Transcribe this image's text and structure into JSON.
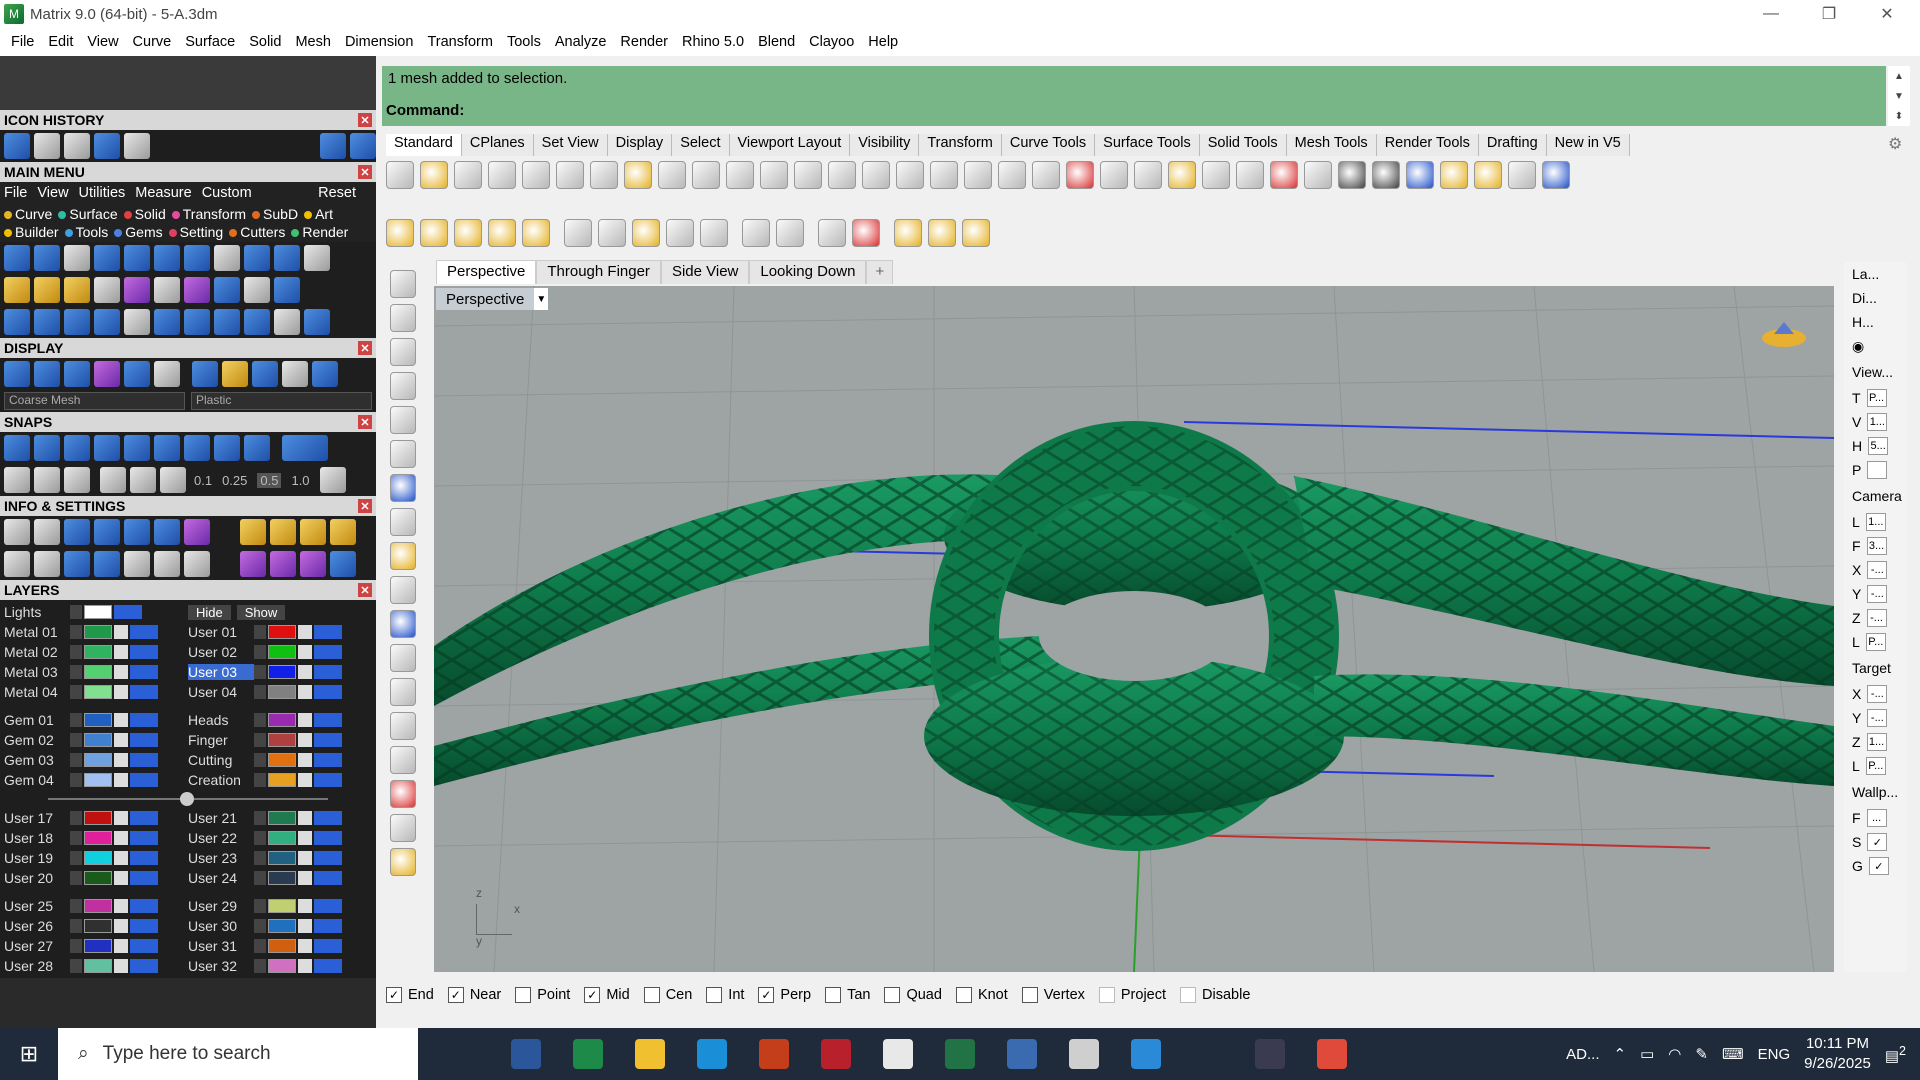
{
  "window": {
    "title": "Matrix 9.0 (64-bit) - 5-A.3dm",
    "controls": [
      "—",
      "❐",
      "✕"
    ]
  },
  "menubar": [
    "File",
    "Edit",
    "View",
    "Curve",
    "Surface",
    "Solid",
    "Mesh",
    "Dimension",
    "Transform",
    "Tools",
    "Analyze",
    "Render",
    "Rhino 5.0",
    "Blend",
    "Clayoo",
    "Help"
  ],
  "left": {
    "icon_history": "ICON HISTORY",
    "main_menu": "MAIN MENU",
    "main_menu_items": [
      "File",
      "View",
      "Utilities",
      "Measure",
      "Custom"
    ],
    "reset": "Reset",
    "categories": [
      {
        "label": "Curve",
        "color": "#e6b422"
      },
      {
        "label": "Surface",
        "color": "#2dbfa3"
      },
      {
        "label": "Solid",
        "color": "#e04040"
      },
      {
        "label": "Transform",
        "color": "#e84aa0"
      },
      {
        "label": "SubD",
        "color": "#e06820"
      },
      {
        "label": "Art",
        "color": "#f0c000"
      },
      {
        "label": "Builder",
        "color": "#f0c000"
      },
      {
        "label": "Tools",
        "color": "#40a0e0"
      },
      {
        "label": "Gems",
        "color": "#4a80e0"
      },
      {
        "label": "Setting",
        "color": "#e04060"
      },
      {
        "label": "Cutters",
        "color": "#e07020"
      },
      {
        "label": "Render",
        "color": "#40c070"
      }
    ],
    "display": "DISPLAY",
    "display_mesh": "Coarse Mesh",
    "display_material": "Plastic",
    "snaps": "SNAPS",
    "snap_values": [
      "0.1",
      "0.25",
      "0.5",
      "1.0"
    ],
    "info": "INFO & SETTINGS",
    "layers": "LAYERS",
    "lights": "Lights",
    "hide": "Hide",
    "show": "Show",
    "layer_rows": [
      [
        {
          "name": "Metal 01",
          "color": "#1f9a4a"
        },
        {
          "name": "User 01",
          "color": "#e01010"
        }
      ],
      [
        {
          "name": "Metal 02",
          "color": "#2fb360"
        },
        {
          "name": "User 02",
          "color": "#10c010"
        }
      ],
      [
        {
          "name": "Metal 03",
          "color": "#55d070"
        },
        {
          "name": "User 03",
          "color": "#1020e8",
          "selected": true
        }
      ],
      [
        {
          "name": "Metal 04",
          "color": "#80e090"
        },
        {
          "name": "User 04",
          "color": "#808080"
        }
      ]
    ],
    "layer_rows2": [
      [
        {
          "name": "Gem 01",
          "color": "#2060c0"
        },
        {
          "name": "Heads",
          "color": "#9a2ab0"
        }
      ],
      [
        {
          "name": "Gem 02",
          "color": "#4080d0"
        },
        {
          "name": "Finger",
          "color": "#b04040"
        }
      ],
      [
        {
          "name": "Gem 03",
          "color": "#70a0e0"
        },
        {
          "name": "Cutting",
          "color": "#e07010"
        }
      ],
      [
        {
          "name": "Gem 04",
          "color": "#a0c0f0"
        },
        {
          "name": "Creation",
          "color": "#e8a020"
        }
      ]
    ],
    "layer_rows3": [
      [
        {
          "name": "User 17",
          "color": "#c01010"
        },
        {
          "name": "User 21",
          "color": "#207a50"
        }
      ],
      [
        {
          "name": "User 18",
          "color": "#e0209a"
        },
        {
          "name": "User 22",
          "color": "#30b080"
        }
      ],
      [
        {
          "name": "User 19",
          "color": "#10d0e0"
        },
        {
          "name": "User 23",
          "color": "#206080"
        }
      ],
      [
        {
          "name": "User 20",
          "color": "#1a5a1a"
        },
        {
          "name": "User 24",
          "color": "#2a3a50"
        }
      ]
    ],
    "layer_rows4": [
      [
        {
          "name": "User 25",
          "color": "#c030a0"
        },
        {
          "name": "User 29",
          "color": "#c0d070"
        }
      ],
      [
        {
          "name": "User 26",
          "color": "#303030"
        },
        {
          "name": "User 30",
          "color": "#2070c0"
        }
      ],
      [
        {
          "name": "User 27",
          "color": "#2030c0"
        },
        {
          "name": "User 31",
          "color": "#d06010"
        }
      ],
      [
        {
          "name": "User 28",
          "color": "#60c0a0"
        },
        {
          "name": "User 32",
          "color": "#d070c0"
        }
      ]
    ]
  },
  "command": {
    "history": "1 mesh added to selection.",
    "prompt": "Command:"
  },
  "toolbar_tabs": [
    "Standard",
    "CPlanes",
    "Set View",
    "Display",
    "Select",
    "Viewport Layout",
    "Visibility",
    "Transform",
    "Curve Tools",
    "Surface Tools",
    "Solid Tools",
    "Mesh Tools",
    "Render Tools",
    "Drafting",
    "New in V5"
  ],
  "viewport_tabs": [
    "Perspective",
    "Through Finger",
    "Side View",
    "Looking Down"
  ],
  "viewport_tab_add": "+",
  "viewport_label": "Perspective",
  "axes": {
    "z": "z",
    "x": "x",
    "y": "y"
  },
  "right_panel": {
    "tabs": [
      "La...",
      "Di...",
      "H..."
    ],
    "view": "View...",
    "view_rows": [
      "T",
      "V",
      "H",
      "P"
    ],
    "view_values": [
      "P...",
      "1...",
      "5...",
      ""
    ],
    "camera": "Camera",
    "camera_rows": [
      "L",
      "F",
      "X",
      "Y",
      "Z",
      "L"
    ],
    "camera_values": [
      "1...",
      "3...",
      "-...",
      "-...",
      "-...",
      "P..."
    ],
    "target": "Target",
    "target_rows": [
      "X",
      "Y",
      "Z",
      "L"
    ],
    "target_values": [
      "-...",
      "-...",
      "1...",
      "P..."
    ],
    "wallpaper": "Wallp...",
    "wall_rows": [
      "F",
      "S",
      "G"
    ],
    "wall_values": [
      "...",
      "✓",
      "✓"
    ]
  },
  "osnaps": [
    {
      "label": "End",
      "checked": true
    },
    {
      "label": "Near",
      "checked": true
    },
    {
      "label": "Point",
      "checked": false
    },
    {
      "label": "Mid",
      "checked": true
    },
    {
      "label": "Cen",
      "checked": false
    },
    {
      "label": "Int",
      "checked": false
    },
    {
      "label": "Perp",
      "checked": true
    },
    {
      "label": "Tan",
      "checked": false
    },
    {
      "label": "Quad",
      "checked": false
    },
    {
      "label": "Knot",
      "checked": false
    },
    {
      "label": "Vertex",
      "checked": false
    },
    {
      "label": "Project",
      "checked": false,
      "disabled": true
    },
    {
      "label": "Disable",
      "checked": false,
      "disabled": true
    }
  ],
  "taskbar": {
    "search_placeholder": "Type here to search",
    "tray_text": "AD...",
    "lang": "ENG",
    "time": "10:11 PM",
    "date": "9/26/2025",
    "notification_count": "2",
    "apps": [
      "task-view",
      "word",
      "matrix",
      "file-explorer",
      "edge",
      "powerpoint",
      "solidworks",
      "chrome",
      "excel",
      "remote-desktop",
      "rhino",
      "app-blue",
      "settings",
      "app-dark",
      "chrome-2"
    ]
  },
  "colors": {
    "command_bg": "#79b687",
    "model_green": "#0e7a4a",
    "viewport_bg": "#9ea3a3"
  }
}
